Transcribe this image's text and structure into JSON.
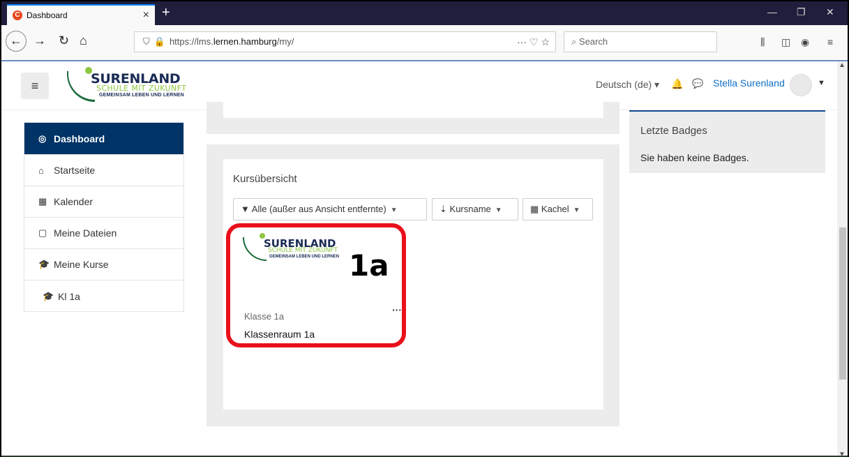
{
  "browser": {
    "tab_title": "Dashboard",
    "tab_favicon_letter": "C",
    "new_tab": "+",
    "url_prefix": "https://lms.",
    "url_domain": "lernen.hamburg",
    "url_path": "/my/",
    "page_actions": "··· ♡ ☆",
    "search_placeholder": "Search"
  },
  "header": {
    "logo_name": "SURENLAND",
    "logo_sub": "SCHULE MIT ZUKUNFT",
    "logo_sub2": "GEMEINSAM LEBEN UND LERNEN",
    "language": "Deutsch (de) ▾",
    "username": "Stella Surenland"
  },
  "sidebar": {
    "items": [
      {
        "label": "Dashboard",
        "icon": "dashboard-icon"
      },
      {
        "label": "Startseite",
        "icon": "home-icon"
      },
      {
        "label": "Kalender",
        "icon": "calendar-icon"
      },
      {
        "label": "Meine Dateien",
        "icon": "file-icon"
      },
      {
        "label": "Meine Kurse",
        "icon": "graduation-cap-icon"
      },
      {
        "label": "Kl 1a",
        "icon": "graduation-cap-icon"
      }
    ]
  },
  "course_overview": {
    "title": "Kursübersicht",
    "filter_label": "Alle (außer aus Ansicht entfernte)",
    "sort_label": "Kursname",
    "view_label": "Kachel",
    "card": {
      "image_tag": "1a",
      "category": "Klasse 1a",
      "menu": "···",
      "name": "Klassenraum 1a"
    }
  },
  "badges": {
    "title": "Letzte Badges",
    "text": "Sie haben keine Badges."
  },
  "colors": {
    "nav_active": "#003366",
    "link": "#0f6fc5",
    "highlight": "#e8101a",
    "logo_green": "#8cc63f"
  }
}
